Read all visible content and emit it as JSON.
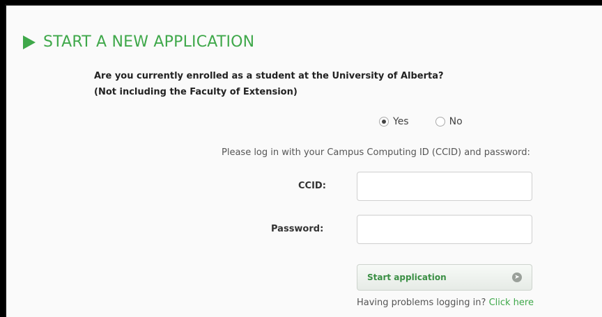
{
  "section": {
    "title": "START A NEW APPLICATION",
    "icon": "play-icon",
    "accent_color": "#3fa84a"
  },
  "question": {
    "line1": "Are you currently enrolled as a student at the University of Alberta?",
    "line2": "(Not including the Faculty of Extension)"
  },
  "enrollment": {
    "options": [
      {
        "label": "Yes",
        "selected": true
      },
      {
        "label": "No",
        "selected": false
      }
    ]
  },
  "login": {
    "instructions": "Please log in with your Campus Computing ID (CCID) and password:",
    "ccid_label": "CCID:",
    "ccid_value": "",
    "password_label": "Password:",
    "password_value": ""
  },
  "actions": {
    "start_label": "Start application",
    "start_icon": "arrow-right-circle-icon"
  },
  "help": {
    "text": "Having problems logging in? ",
    "link_text": "Click here"
  }
}
